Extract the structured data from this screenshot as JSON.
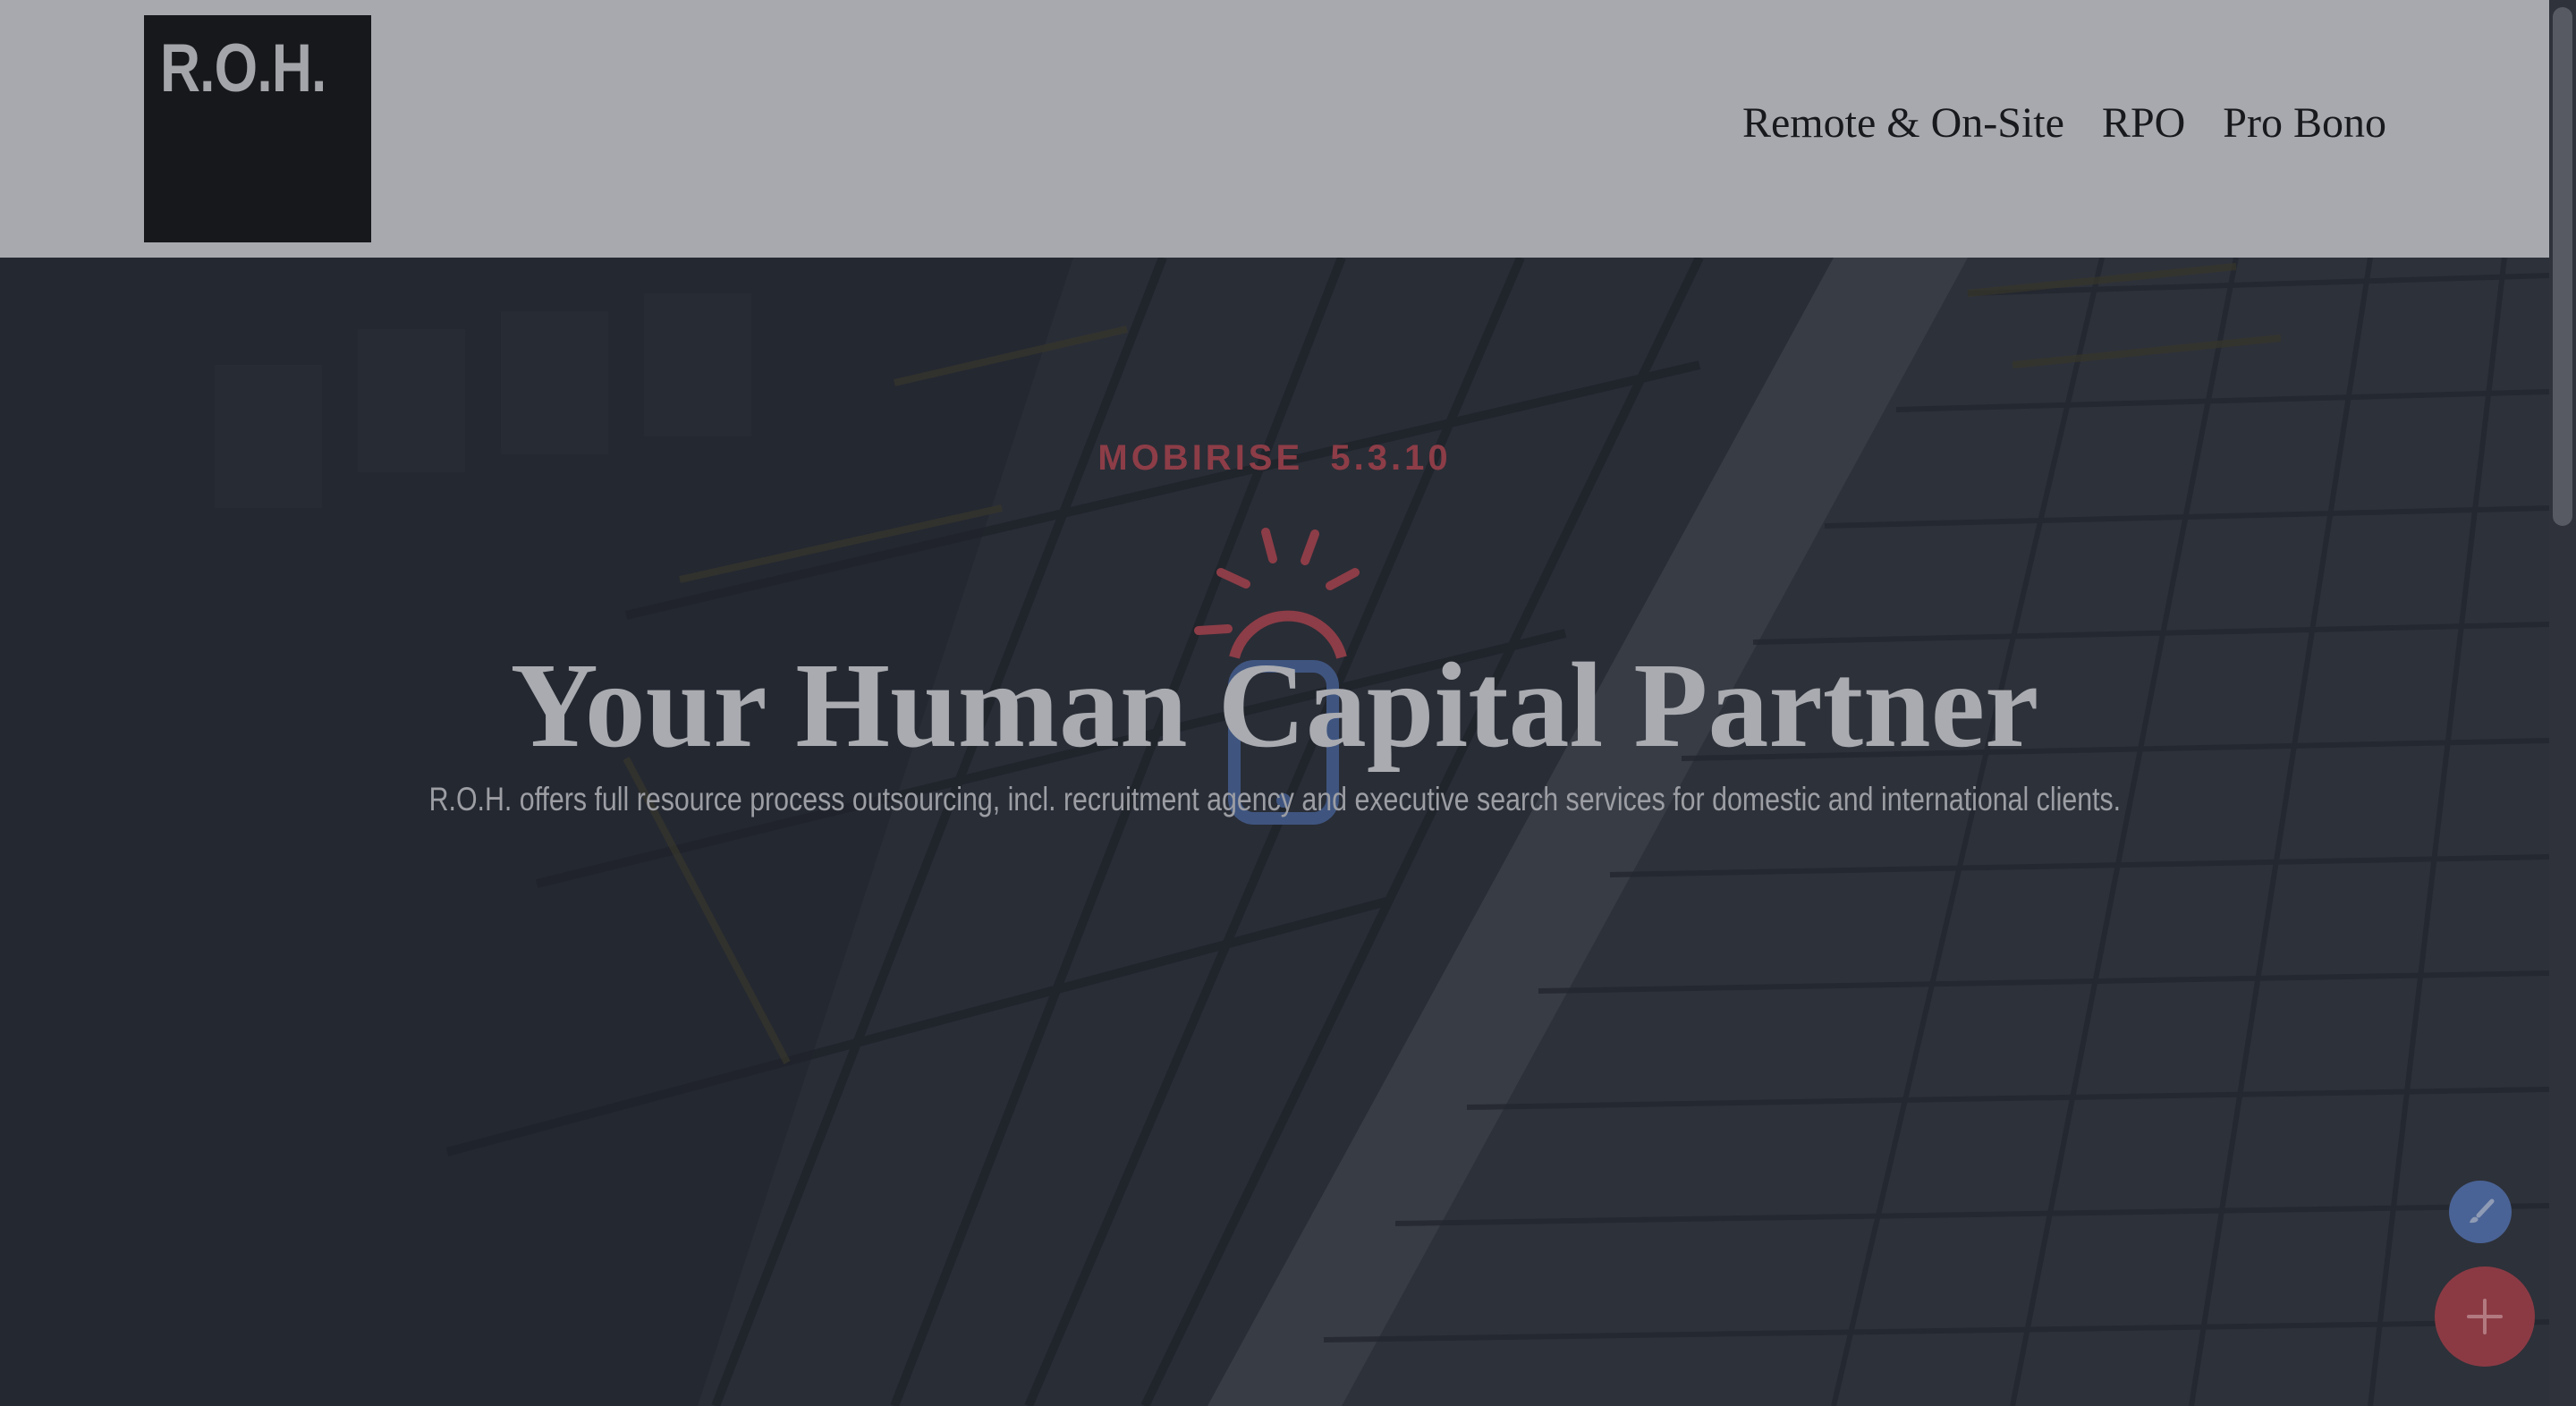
{
  "brand": {
    "logo_text": "R.O.H."
  },
  "nav": {
    "items": [
      {
        "label": "Remote & On-Site"
      },
      {
        "label": "RPO"
      },
      {
        "label": "Pro Bono"
      }
    ]
  },
  "hero": {
    "eyebrow": "MOBIRISE  5.3.10",
    "title": "Your Human Capital Partner",
    "subtitle": "R.O.H. offers full resource process outsourcing, incl. recruitment agency and executive search services for domestic and international clients."
  },
  "colors": {
    "topbar": "#a7a9ae",
    "logo_bg": "#16181c",
    "eyebrow": "#8d3d47",
    "fab_edit": "#4a6396",
    "fab_add": "#8b3a44"
  },
  "icons": {
    "center": "mobile-sun-icon",
    "edit": "brush-icon",
    "add": "plus-icon"
  }
}
